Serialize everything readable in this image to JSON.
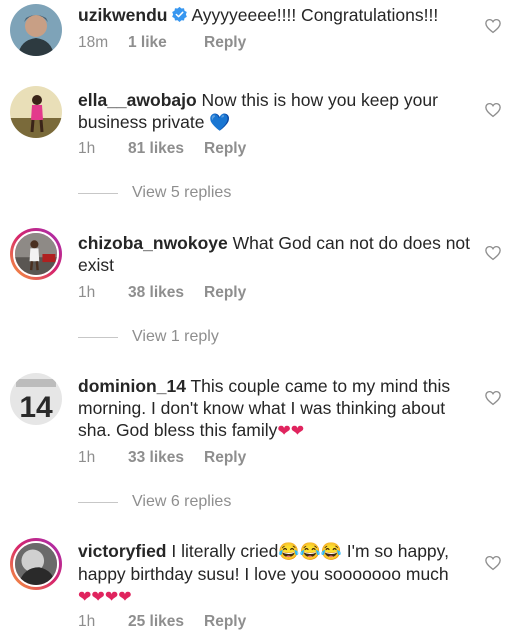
{
  "comments": [
    {
      "username": "uzikwendu",
      "verified": true,
      "text": "Ayyyyeeee!!!! Congratulations!!!",
      "emoji": "",
      "time": "18m",
      "likes": "1 like",
      "reply": "Reply"
    },
    {
      "username": "ella__awobajo",
      "text": "Now this is how you keep your business private",
      "emoji": "💙",
      "time": "1h",
      "likes": "81 likes",
      "reply": "Reply",
      "view_replies": "View 5 replies"
    },
    {
      "username": "chizoba_nwokoye",
      "text": "What God can not do does not exist",
      "emoji": "",
      "time": "1h",
      "likes": "38 likes",
      "reply": "Reply",
      "view_replies": "View 1 reply"
    },
    {
      "username": "dominion_14",
      "avatar_text": "14",
      "text": "This couple came to my mind this morning. I don't know what I was thinking about sha. God bless this family",
      "emoji": "❤❤",
      "time": "1h",
      "likes": "33 likes",
      "reply": "Reply",
      "view_replies": "View 6 replies"
    },
    {
      "username": "victoryfied",
      "text_a": "I literally cried",
      "emoji_a": "😂😂😂",
      "text_b": " I'm so happy, happy birthday susu! I love you sooooooo much",
      "emoji": "❤❤❤❤",
      "time": "1h",
      "likes": "25 likes",
      "reply": "Reply"
    }
  ],
  "icons": {
    "like": "heart-outline-icon",
    "verified": "verified-badge-icon"
  },
  "colors": {
    "text": "#262626",
    "muted": "#8e8e8e",
    "verified": "#3897f0",
    "heart": "#e0245e"
  }
}
